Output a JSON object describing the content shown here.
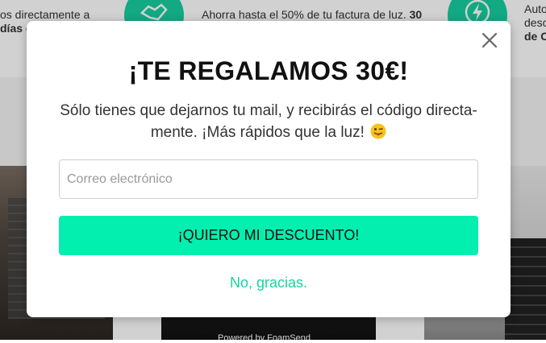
{
  "background": {
    "feature_1": {
      "text": "os directamente a",
      "bold": "días d"
    },
    "feature_2": {
      "text": "Ahorra hasta el 50% de tu factura de luz.",
      "bold": "30"
    },
    "feature_3": {
      "line1": "Auto",
      "line2": "desc",
      "bold": "de C"
    },
    "powered_by": "Powered by FoamSend"
  },
  "modal": {
    "title": "¡TE REGALAMOS 30€!",
    "subtitle_line1": "Sólo tienes que dejarnos tu mail, y recibirás el código directa-",
    "subtitle_line2": "mente. ¡Más rápidos que la luz!",
    "email_placeholder": "Correo electrónico",
    "email_value": "",
    "cta_label": "¡QUIERO MI DESCUENTO!",
    "dismiss_label": "No, gracias."
  },
  "colors": {
    "accent": "#03efb0",
    "link": "#14d6a0",
    "icon_bg": "#17cfa0"
  },
  "icons": [
    "close-icon",
    "winking-tongue-emoji",
    "handshake-icon",
    "bolt-icon"
  ]
}
